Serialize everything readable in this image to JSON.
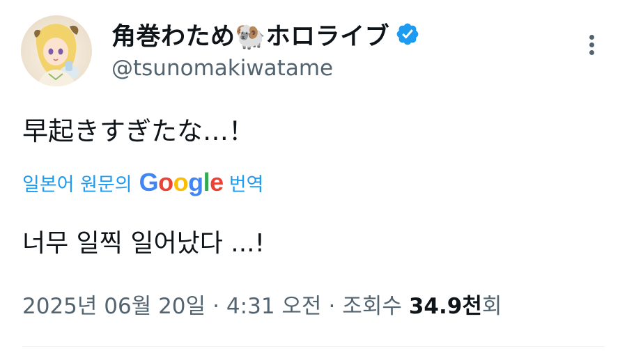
{
  "author": {
    "display_name": "角巻わため🐏ホロライブ",
    "handle": "@tsunomakiwatame",
    "verified": true
  },
  "tweet": {
    "text": "早起きすぎたな…！"
  },
  "translation": {
    "label_prefix": "일본어 원문의",
    "logo": {
      "g1": "G",
      "o1": "o",
      "o2": "o",
      "g2": "g",
      "l": "l",
      "e": "e"
    },
    "label_suffix": "번역",
    "text": "너무 일찍 일어났다 ...!"
  },
  "meta": {
    "date": "2025년 06월 20일",
    "separator": "·",
    "time": "4:31 오전",
    "views_label": "조회수",
    "views_count": "34.9천",
    "views_suffix": "회"
  },
  "colors": {
    "link_blue": "#1d9bf0",
    "secondary_text": "#536471",
    "primary_text": "#0f1419",
    "verified_badge": "#1d9bf0"
  },
  "icons": {
    "verified": "verified-badge-icon",
    "more": "more-vertical-icon"
  }
}
